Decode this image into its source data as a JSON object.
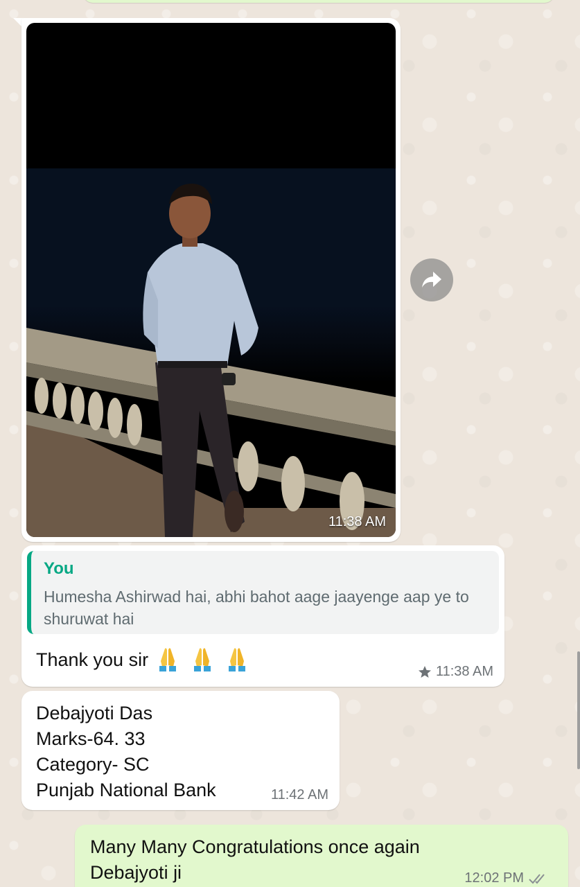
{
  "photo_message": {
    "time": "11:38 AM"
  },
  "forward_button": {
    "icon": "forward-icon"
  },
  "reply_message": {
    "quote_author": "You",
    "quote_text": "Humesha Ashirwad hai, abhi bahot aage jaayenge aap ye to shuruwat hai",
    "text": "Thank you sir",
    "emoji": "🙏🙏🙏",
    "time": "11:38 AM",
    "starred": true
  },
  "details_message": {
    "lines": [
      "Debajyoti Das",
      "Marks-64. 33",
      "Category- SC",
      "Punjab National Bank"
    ],
    "time": "11:42 AM"
  },
  "outgoing_message": {
    "text": "Many Many Congratulations once again Debajyoti ji",
    "time": "12:02 PM",
    "status": "read"
  },
  "colors": {
    "incoming_bubble": "#ffffff",
    "outgoing_bubble": "#e2f8cd",
    "quote_accent": "#06a884",
    "background": "#ece5dd"
  }
}
